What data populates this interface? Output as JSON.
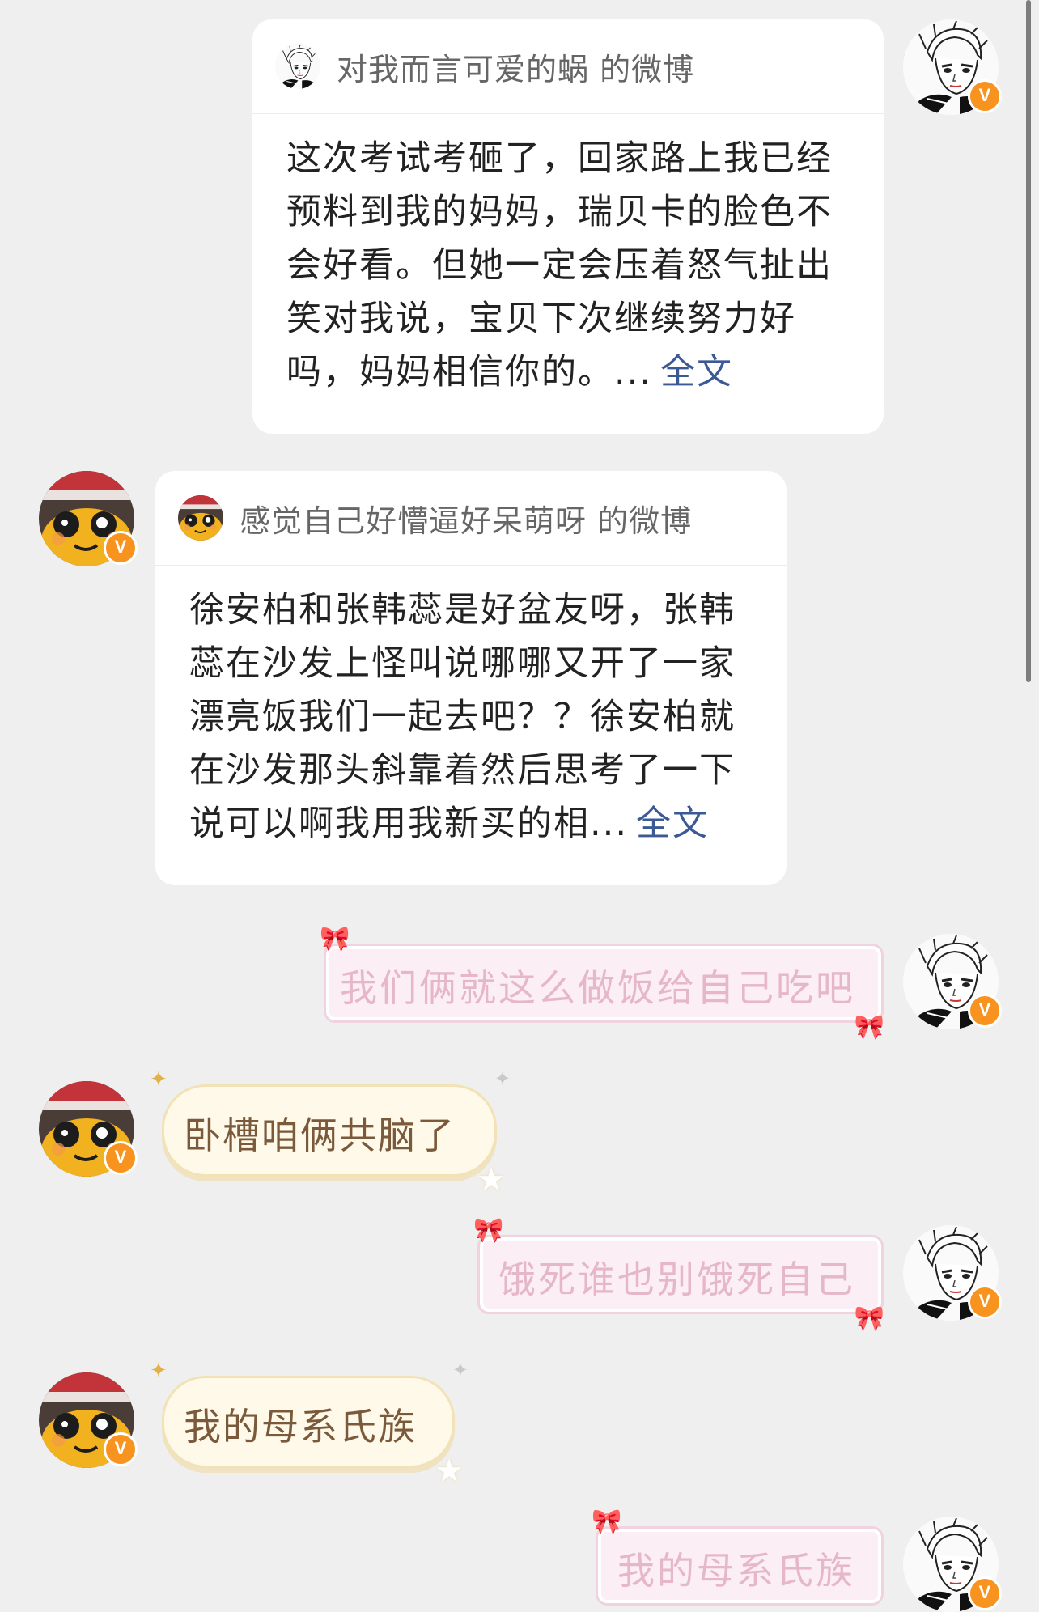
{
  "messages": [
    {
      "type": "weibo-card",
      "side": "right",
      "title": "对我而言可爱的蜗 的微博",
      "lines": [
        "这次考试考砸了，回家路上我已经",
        "预料到我的妈妈，瑞贝卡的脸色不",
        "会好看。但她一定会压着怒气扯出",
        "笑对我说，宝贝下次继续努力好",
        "吗，妈妈相信你的。..."
      ],
      "more": "全文"
    },
    {
      "type": "weibo-card",
      "side": "left",
      "title": "感觉自己好懵逼好呆萌呀 的微博",
      "lines": [
        "徐安柏和张韩蕊是好盆友呀，张韩",
        "蕊在沙发上怪叫说哪哪又开了一家",
        "漂亮饭我们一起去吧？？徐安柏就",
        "在沙发那头斜靠着然后思考了一下",
        "说可以啊我用我新买的相..."
      ],
      "more": "全文"
    },
    {
      "type": "text",
      "side": "right",
      "text": "我们俩就这么做饭给自己吃吧"
    },
    {
      "type": "text",
      "side": "left",
      "text": "卧槽咱俩共脑了"
    },
    {
      "type": "text",
      "side": "right",
      "text": "饿死谁也别饿死自己"
    },
    {
      "type": "text",
      "side": "left",
      "text": "我的母系氏族"
    },
    {
      "type": "text",
      "side": "right",
      "text": "我的母系氏族"
    }
  ],
  "badge": "V",
  "colors": {
    "background": "#efefef",
    "link": "#3b5a95",
    "vip": "#f7931e"
  }
}
